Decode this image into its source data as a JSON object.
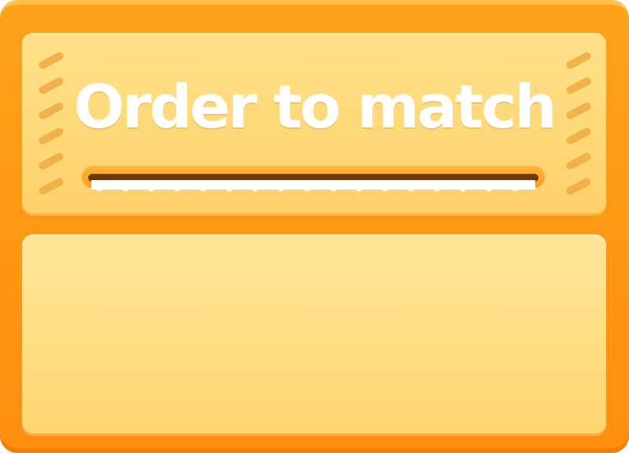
{
  "title": "Order to match",
  "colors": {
    "frame": "#ff9612",
    "panel": "#ffdd82",
    "title_text": "#ffffff",
    "slot": "#6a3a0c",
    "vent": "#f0b24a"
  }
}
